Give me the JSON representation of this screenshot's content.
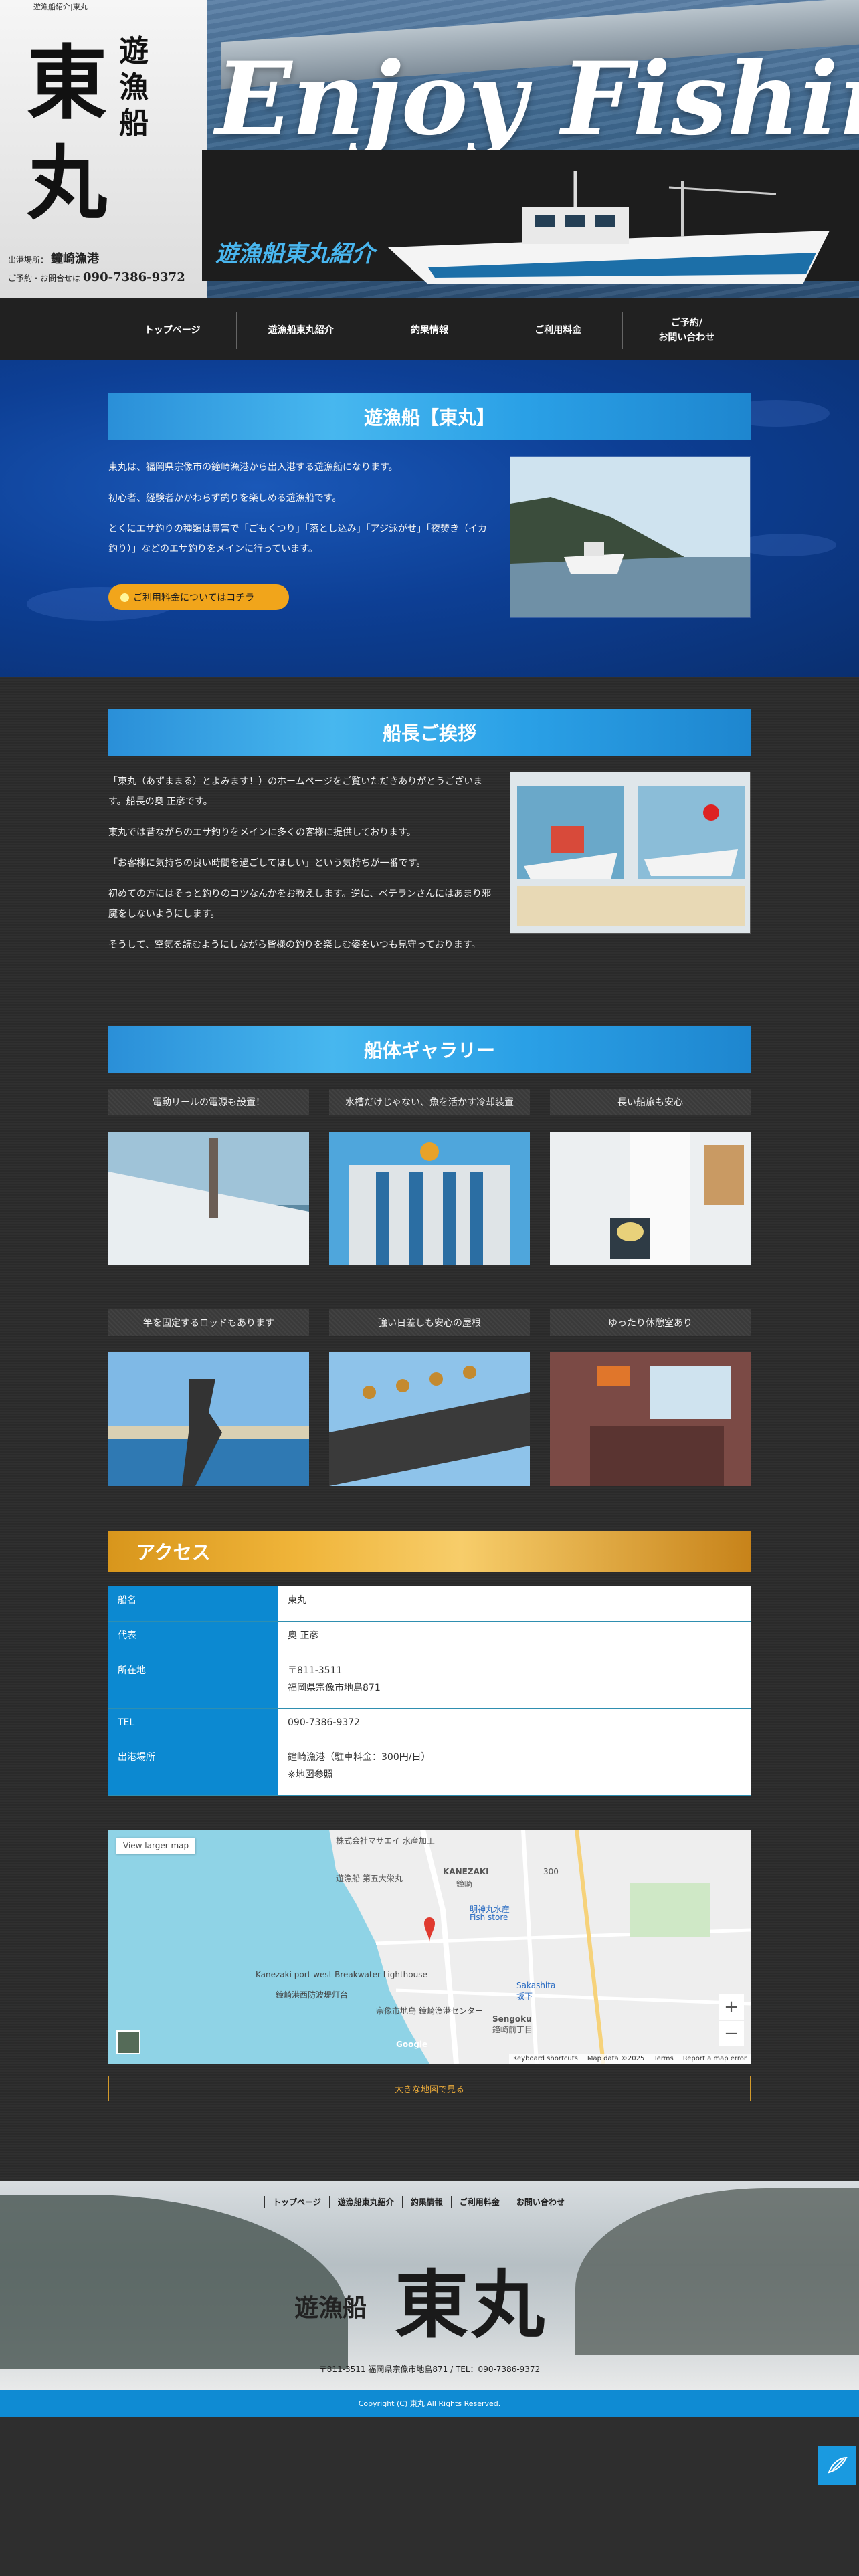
{
  "header": {
    "caption": "遊漁船紹介|東丸",
    "logo_main": "東丸",
    "logo_sub": "遊漁船",
    "port_label": "出港場所：",
    "port_value": "鐘崎漁港",
    "tel_label": "ご予約・お問合せは",
    "tel_value": "090-7386-9372",
    "hero_title": "Enjoy Fishing",
    "hero_subtitle": "遊漁船東丸紹介"
  },
  "nav": {
    "items": [
      "トップページ",
      "遊漁船東丸紹介",
      "釣果情報",
      "ご利用料金",
      "ご予約/\nお問い合わせ"
    ]
  },
  "intro": {
    "heading": "遊漁船【東丸】",
    "p1": "東丸は、福岡県宗像市の鐘崎漁港から出入港する遊漁船になります。",
    "p2": "初心者、経験者かかわらず釣りを楽しめる遊漁船です。",
    "p3": "とくにエサ釣りの種類は豊富で「ごもくつり」「落とし込み」「アジ泳がせ」「夜焚き（イカ釣り）」などのエサ釣りをメインに行っています。",
    "button": "ご利用料金についてはコチラ"
  },
  "greeting": {
    "heading": "船長ご挨拶",
    "p1": "「東丸（あずままる）とよみます！）のホームページをご覧いただきありがとうございます。船長の奥 正彦です。",
    "p2": "東丸では昔ながらのエサ釣りをメインに多くの客様に提供しております。",
    "p3": "「お客様に気持ちの良い時間を過ごしてほしい」という気持ちが一番です。",
    "p4": "初めての方にはそっと釣りのコツなんかをお教えします。逆に、ベテランさんにはあまり邪魔をしないようにします。",
    "p5": "そうして、空気を読むようにしながら皆様の釣りを楽しむ姿をいつも見守っております。"
  },
  "gallery": {
    "heading": "船体ギャラリー",
    "items": [
      {
        "caption": "電動リールの電源も設置！"
      },
      {
        "caption": "水槽だけじゃない、魚を活かす冷却装置"
      },
      {
        "caption": "長い船旅も安心"
      },
      {
        "caption": "竿を固定するロッドもあります"
      },
      {
        "caption": "強い日差しも安心の屋根"
      },
      {
        "caption": "ゆったり休憩室あり"
      }
    ]
  },
  "access": {
    "heading": "アクセス",
    "rows": [
      {
        "key": "船名",
        "value": "東丸"
      },
      {
        "key": "代表",
        "value": "奥 正彦"
      },
      {
        "key": "所在地",
        "value": "〒811-3511",
        "value2": "福岡県宗像市地島871"
      },
      {
        "key": "TEL",
        "value": "090-7386-9372"
      },
      {
        "key": "出港場所",
        "value": "鐘崎漁港（駐車料金：300円/日）",
        "value2": "※地図参照"
      }
    ]
  },
  "map": {
    "view_larger": "View larger map",
    "labels": [
      "株式会社マサエイ 水産加工",
      "遊漁船 第五大栄丸",
      "KANEZAKI",
      "鐘崎",
      "明神丸水産",
      "Fish store",
      "Kanezaki port west Breakwater Lighthouse",
      "鐘崎港西防波堤灯台",
      "Sakashita",
      "坂下",
      "宗像市地島 鐘崎漁港センター",
      "Sengoku",
      "鐘崎前丁目",
      "Google",
      "300"
    ],
    "footer": [
      "Keyboard shortcuts",
      "Map data ©2025",
      "Terms",
      "Report a map error"
    ],
    "big_map": "大きな地図で見る"
  },
  "footer": {
    "nav": [
      "トップページ",
      "遊漁船東丸紹介",
      "釣果情報",
      "ご利用料金",
      "お問い合わせ"
    ],
    "logo_sub": "遊漁船",
    "logo_main": "東丸",
    "address": "〒811-3511 福岡県宗像市地島871 / TEL：090-7386-9372",
    "copyright": "Copyright (C) 東丸 All Rights Reserved."
  },
  "colors": {
    "accent_blue": "#0c89d1",
    "accent_orange": "#f1a51b",
    "header_dark": "#212121"
  }
}
